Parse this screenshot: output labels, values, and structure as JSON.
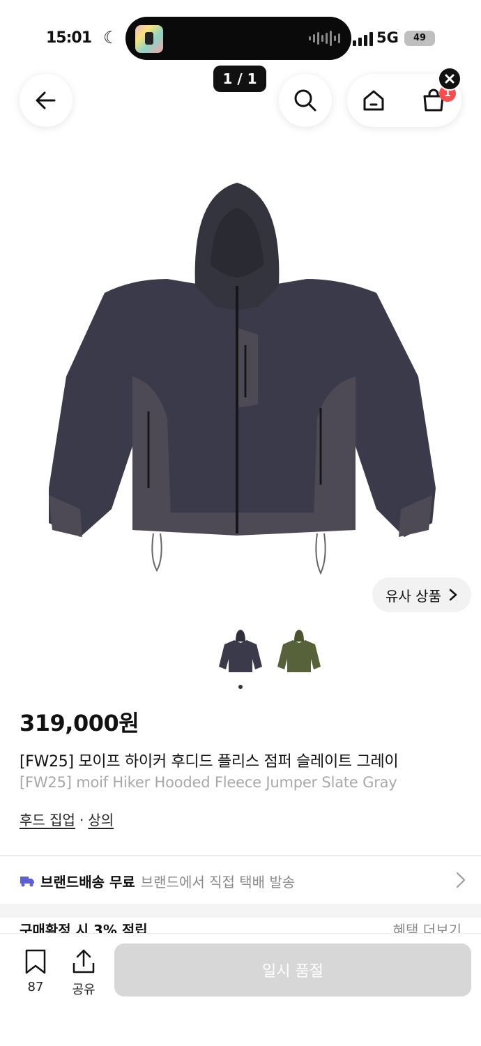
{
  "status_bar": {
    "time": "15:01",
    "network": "5G",
    "battery": "49"
  },
  "top_nav": {
    "page_indicator": "1 / 1",
    "cart_badge": "1"
  },
  "product": {
    "similar_button": "유사 상품",
    "price": "319,000원",
    "title_ko": "[FW25] 모이프 하이커 후디드 플리스 점퍼 슬레이트 그레이",
    "title_en": "[FW25] moif Hiker Hooded Fleece Jumper Slate Gray",
    "category_1": "후드 집업",
    "category_sep": "·",
    "category_2": "상의",
    "color_variants": [
      "slate gray",
      "olive"
    ]
  },
  "shipping": {
    "strong": "브랜드배송 무료",
    "sub": "브랜드에서 직접 택배 발송"
  },
  "reward": {
    "label": "구매확정 시 3% 적립",
    "more": "혜택 더보기"
  },
  "bottom_bar": {
    "bookmark_count": "87",
    "share_label": "공유",
    "soldout_label": "일시 품절"
  },
  "colors": {
    "accent_shipping_icon": "#5b5fd6",
    "badge": "#ff4d4d",
    "soldout_bg": "#d7d7d7"
  }
}
